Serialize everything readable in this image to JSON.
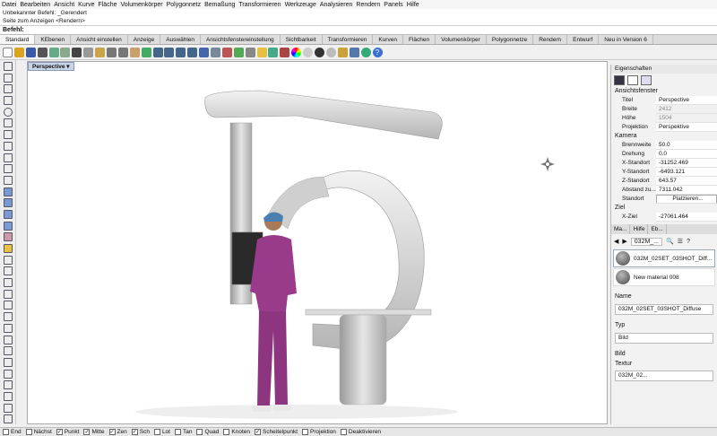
{
  "menu": [
    "Datei",
    "Bearbeiten",
    "Ansicht",
    "Kurve",
    "Fläche",
    "Volumenkörper",
    "Polygonnetz",
    "Bemaßung",
    "Transformieren",
    "Werkzeuge",
    "Analysieren",
    "Rendern",
    "Panels",
    "Hilfe"
  ],
  "command": {
    "history1": "Unbekannter Befehl: _Gerendert",
    "history2": "Seite zum Anzeigen <Rendern>",
    "prompt": "Befehl:"
  },
  "tabs": [
    "Standard",
    "KEbenen",
    "Ansicht einstellen",
    "Anzeige",
    "Auswählen",
    "Ansichtsfenstereinstellung",
    "Sichtbarkeit",
    "Transformieren",
    "Kurven",
    "Flächen",
    "Volumenkörper",
    "Polygonnetze",
    "Rendern",
    "Entwurf",
    "Neu in Version 6"
  ],
  "viewport": {
    "label": "Perspective ▾"
  },
  "properties": {
    "title": "Eigenschaften",
    "section_view": "Ansichtsfenster",
    "rows_view": [
      {
        "k": "Titel",
        "v": "Perspective"
      },
      {
        "k": "Breite",
        "v": "2412"
      },
      {
        "k": "Höhe",
        "v": "1504"
      },
      {
        "k": "Projektion",
        "v": "Perspektive"
      }
    ],
    "section_camera": "Kamera",
    "rows_camera": [
      {
        "k": "Brennweite",
        "v": "50.0"
      },
      {
        "k": "Drehung",
        "v": "0.0"
      },
      {
        "k": "X-Standort",
        "v": "-31252.469"
      },
      {
        "k": "Y-Standort",
        "v": "-6493.121"
      },
      {
        "k": "Z-Standort",
        "v": "643.57"
      },
      {
        "k": "Abstand zu...",
        "v": "7311.042"
      }
    ],
    "standort_label": "Standort",
    "place_button": "Platzieren...",
    "section_target": "Ziel",
    "x_target_label": "X-Ziel",
    "x_target_value": "-27061.464"
  },
  "materials": {
    "tabs": [
      "Ma...",
      "Hilfe",
      "Eb..."
    ],
    "breadcrumb": "032M_...",
    "items": [
      "032M_02SET_03SHOT_Diff...",
      "New material 008"
    ],
    "name_label": "Name",
    "name_value": "032M_02SET_03SHOT_Diffuse",
    "type_label": "Typ",
    "type_value": "Bild",
    "image_label": "Bild",
    "texture_label": "Textur",
    "texture_value": "032M_02..."
  },
  "status": [
    {
      "label": "End",
      "checked": false
    },
    {
      "label": "Nächst",
      "checked": false
    },
    {
      "label": "Punkt",
      "checked": true
    },
    {
      "label": "Mitte",
      "checked": true
    },
    {
      "label": "Zen",
      "checked": true
    },
    {
      "label": "Sch",
      "checked": true
    },
    {
      "label": "Lot",
      "checked": false
    },
    {
      "label": "Tan",
      "checked": false
    },
    {
      "label": "Quad",
      "checked": false
    },
    {
      "label": "Knoten",
      "checked": false
    },
    {
      "label": "Scheitelpunkt",
      "checked": true
    },
    {
      "label": "Projektion",
      "checked": false
    },
    {
      "label": "Deaktivieren",
      "checked": false
    }
  ]
}
